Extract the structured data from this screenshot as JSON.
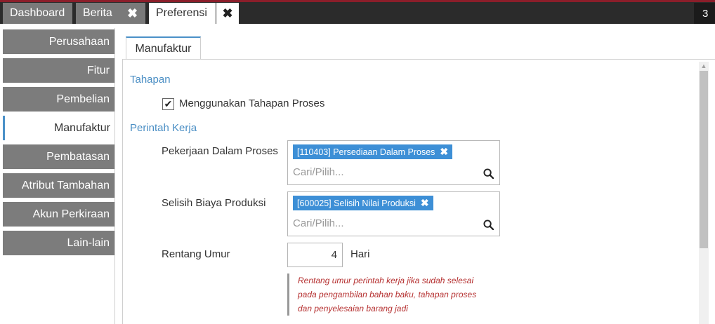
{
  "tabs": {
    "dashboard": "Dashboard",
    "berita": "Berita",
    "preferensi": "Preferensi",
    "close_glyph": "✖",
    "open_count": "3"
  },
  "sidebar": {
    "items": [
      {
        "label": "Perusahaan",
        "active": false
      },
      {
        "label": "Fitur",
        "active": false
      },
      {
        "label": "Pembelian",
        "active": false
      },
      {
        "label": "Manufaktur",
        "active": true
      },
      {
        "label": "Pembatasan",
        "active": false
      },
      {
        "label": "Atribut Tambahan",
        "active": false
      },
      {
        "label": "Akun Perkiraan",
        "active": false
      },
      {
        "label": "Lain-lain",
        "active": false
      }
    ]
  },
  "content": {
    "tab_label": "Manufaktur",
    "tahapan": {
      "heading": "Tahapan",
      "checkbox_label": "Menggunakan Tahapan Proses",
      "checked": true
    },
    "perintah_kerja": {
      "heading": "Perintah Kerja",
      "wip": {
        "label": "Pekerjaan Dalam Proses",
        "tag": "[110403] Persediaan Dalam Proses",
        "placeholder": "Cari/Pilih..."
      },
      "selisih": {
        "label": "Selisih Biaya Produksi",
        "tag": "[600025] Selisih Nilai Produksi",
        "placeholder": "Cari/Pilih..."
      },
      "rentang": {
        "label": "Rentang Umur",
        "value": "4",
        "unit": "Hari",
        "note_lines": [
          "Rentang umur perintah kerja jika sudah selesai",
          "pada pengambilan bahan baku, tahapan proses",
          "dan penyelesaian barang jadi"
        ]
      }
    }
  },
  "colors": {
    "accent_blue": "#4a8ec4",
    "tag_blue": "#3d8fd6",
    "nav_grey": "#7c7c7c",
    "note_red": "#b53030"
  }
}
